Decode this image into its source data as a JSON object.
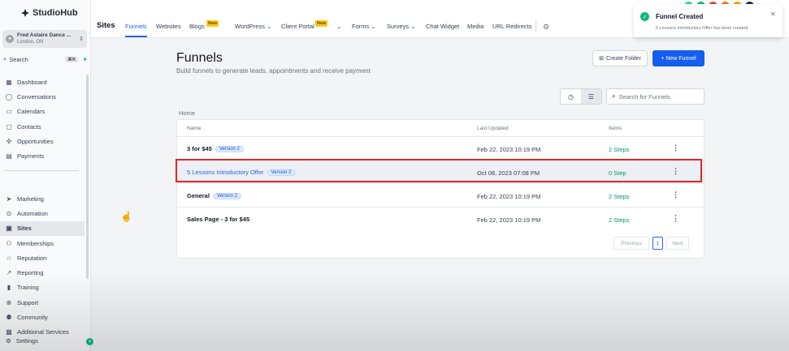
{
  "brand": {
    "name": "StudioHub"
  },
  "account": {
    "name": "Fred Astaire Dance ...",
    "location": "London, ON"
  },
  "sidebar": {
    "search_label": "Search",
    "search_shortcut": "⌘K",
    "items": [
      {
        "label": "Dashboard",
        "icon": "dashboard-icon"
      },
      {
        "label": "Conversations",
        "icon": "chat-icon"
      },
      {
        "label": "Calendars",
        "icon": "calendar-icon"
      },
      {
        "label": "Contacts",
        "icon": "contacts-icon"
      },
      {
        "label": "Opportunities",
        "icon": "opportunities-icon"
      },
      {
        "label": "Payments",
        "icon": "payments-icon"
      }
    ],
    "items2": [
      {
        "label": "Marketing",
        "icon": "send-icon"
      },
      {
        "label": "Automation",
        "icon": "automation-icon"
      },
      {
        "label": "Sites",
        "icon": "sites-icon"
      },
      {
        "label": "Memberships",
        "icon": "memberships-icon"
      },
      {
        "label": "Reputation",
        "icon": "star-icon"
      },
      {
        "label": "Reporting",
        "icon": "reporting-icon"
      },
      {
        "label": "Training",
        "icon": "book-icon"
      },
      {
        "label": "Support",
        "icon": "support-icon"
      },
      {
        "label": "Community",
        "icon": "community-icon"
      },
      {
        "label": "Additional Services",
        "icon": "services-icon"
      }
    ],
    "settings_label": "Settings",
    "settings_badge": "4"
  },
  "topnav": {
    "section": "Sites",
    "tabs": [
      "Funnels",
      "Websites",
      "Blogs",
      "WordPress",
      "Client Portal",
      "Forms",
      "Surveys",
      "Chat Widget",
      "Media",
      "URL Redirects"
    ],
    "new_badge": "New"
  },
  "page": {
    "title": "Funnels",
    "subtitle": "Build funnels to generate leads, appointments and receive payment",
    "create_folder_label": "Create Folder",
    "new_funnel_label": "+ New Funnel",
    "search_placeholder": "Search for Funnels",
    "breadcrumb": "Home"
  },
  "table": {
    "headers": {
      "name": "Name",
      "updated": "Last Updated",
      "items": "Items"
    },
    "rows": [
      {
        "name": "3 for $45",
        "version": "Version 2",
        "updated": "Feb 22, 2023 10:19 PM",
        "items": "2 Steps"
      },
      {
        "name": "5 Lessons Introductory Offer",
        "version": "Version 2",
        "updated": "Oct 08, 2023 07:08 PM",
        "items": "0 Step"
      },
      {
        "name": "General",
        "version": "Version 2",
        "updated": "Feb 22, 2023 10:19 PM",
        "items": "2 Steps"
      },
      {
        "name": "Sales Page - 3 for $45",
        "version": "",
        "updated": "Feb 22, 2023 10:19 PM",
        "items": "2 Steps"
      }
    ]
  },
  "pagination": {
    "prev": "Previous",
    "page": "1",
    "next": "Next"
  },
  "toast": {
    "title": "Funnel Created",
    "message": "5 Lessons Introductory Offer has been created."
  },
  "colors": {
    "accent": "#155eef",
    "success": "#10b981",
    "highlight": "#dc2626"
  }
}
